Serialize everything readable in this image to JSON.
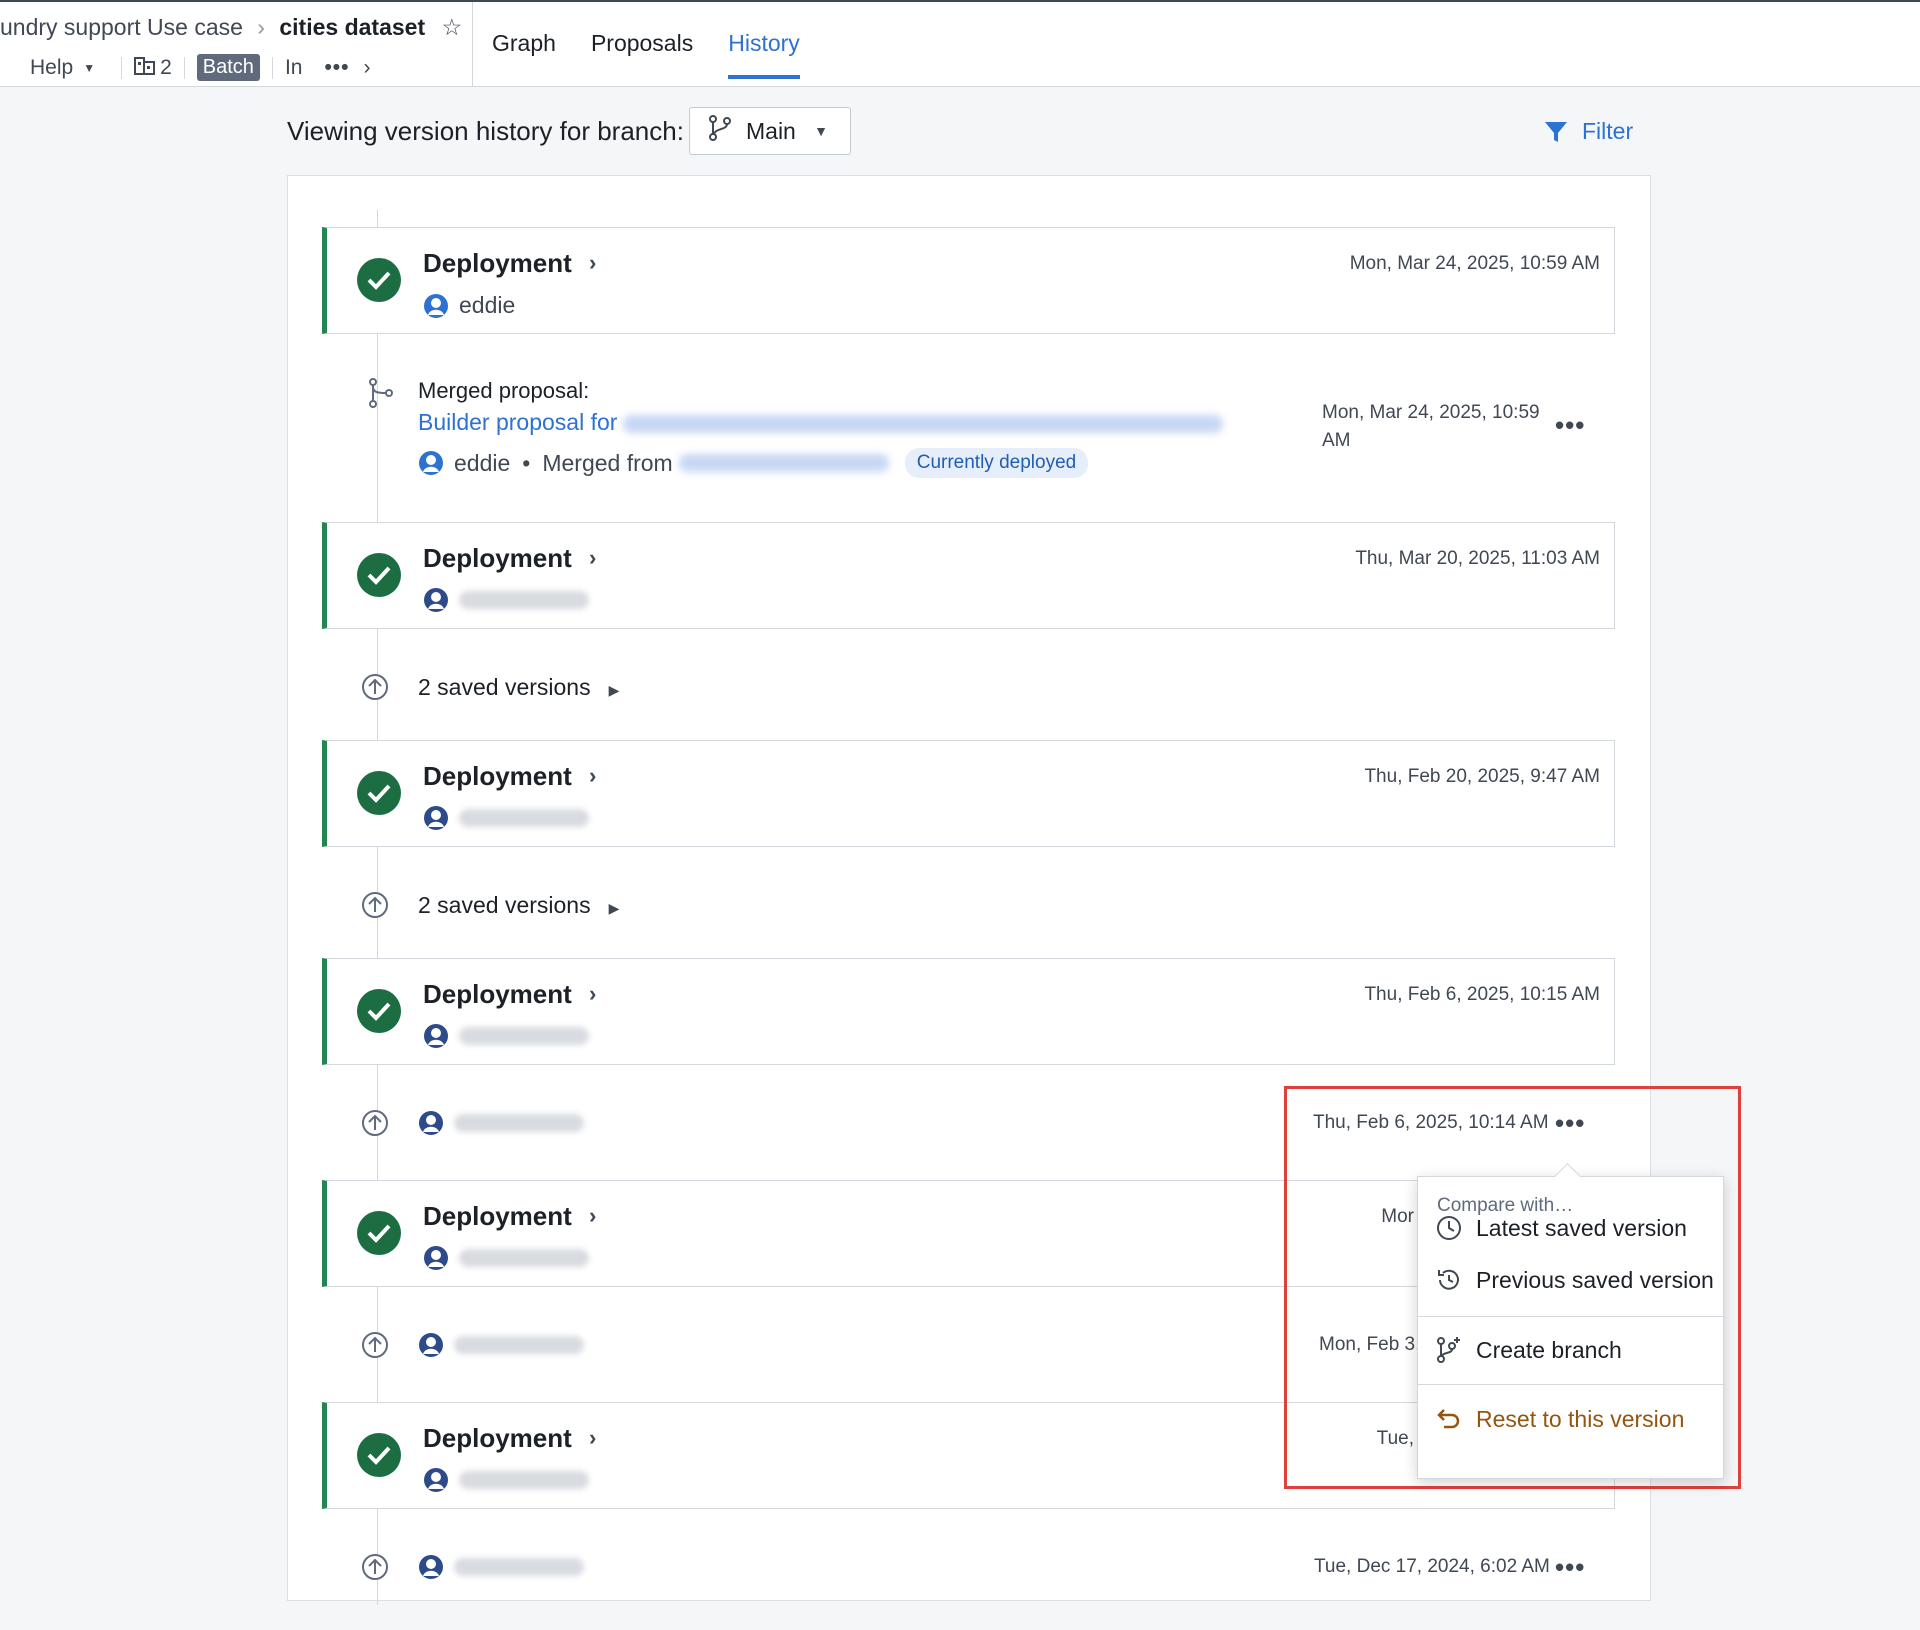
{
  "header": {
    "breadcrumb_project": "undry support Use case",
    "breadcrumb_dataset": "cities dataset",
    "help_label": "Help",
    "building_count": "2",
    "batch_label": "Batch",
    "in_label": "In"
  },
  "tabs": [
    {
      "label": "Graph"
    },
    {
      "label": "Proposals"
    },
    {
      "label": "History",
      "active": true
    }
  ],
  "toolbar": {
    "viewing_label": "Viewing version history for branch:",
    "branch": "Main",
    "filter_label": "Filter"
  },
  "history": {
    "entries": [
      {
        "type": "deployment",
        "title": "Deployment",
        "user": "eddie",
        "date": "Mon, Mar 24, 2025, 10:59 AM"
      },
      {
        "type": "merged_proposal",
        "title": "Merged proposal:",
        "link_text": "Builder proposal for",
        "user": "eddie",
        "merged_from_label": "Merged from",
        "badge": "Currently deployed",
        "date_line1": "Mon, Mar 24, 2025, 10:59",
        "date_line2": "AM"
      },
      {
        "type": "deployment",
        "title": "Deployment",
        "date": "Thu, Mar 20, 2025, 11:03 AM"
      },
      {
        "type": "saved_versions",
        "label": "2 saved versions"
      },
      {
        "type": "deployment",
        "title": "Deployment",
        "date": "Thu, Feb 20, 2025, 9:47 AM"
      },
      {
        "type": "saved_versions",
        "label": "2 saved versions"
      },
      {
        "type": "deployment",
        "title": "Deployment",
        "date": "Thu, Feb 6, 2025, 10:15 AM"
      },
      {
        "type": "saved",
        "date": "Thu, Feb 6, 2025, 10:14 AM"
      },
      {
        "type": "deployment",
        "title": "Deployment",
        "date": "Mor"
      },
      {
        "type": "saved",
        "date": "Mon, Feb 3,"
      },
      {
        "type": "deployment",
        "title": "Deployment",
        "date": "Tue,"
      },
      {
        "type": "saved",
        "date": "Tue, Dec 17, 2024, 6:02 AM"
      }
    ]
  },
  "context_menu": {
    "header": "Compare with…",
    "items": [
      {
        "label": "Latest saved version",
        "icon": "clock-icon"
      },
      {
        "label": "Previous saved version",
        "icon": "history-icon"
      },
      {
        "label": "Create branch",
        "icon": "git-new-branch-icon"
      },
      {
        "label": "Reset to this version",
        "icon": "undo-icon"
      }
    ]
  },
  "colors": {
    "accent": "#2d72d2",
    "success": "#238551",
    "highlight": "#e0403a",
    "warning_text": "#935610"
  }
}
